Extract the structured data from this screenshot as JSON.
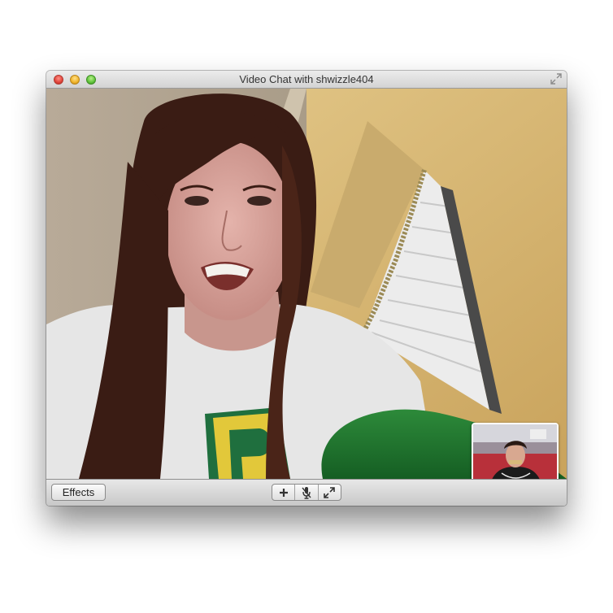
{
  "window": {
    "title": "Video Chat with shwizzle404"
  },
  "toolbar": {
    "effects_label": "Effects",
    "icons": [
      "add-participant-icon",
      "mute-microphone-icon",
      "fullscreen-icon"
    ]
  },
  "colors": {
    "titlebar": "#dcdcdc",
    "close": "#e0443a",
    "minimize": "#f0b42a",
    "zoom": "#5fc33a",
    "wall": "#d4b36c",
    "shirt": "#e6e6e6",
    "blanket": "#1f7a2f",
    "hair": "#3a1c14"
  }
}
